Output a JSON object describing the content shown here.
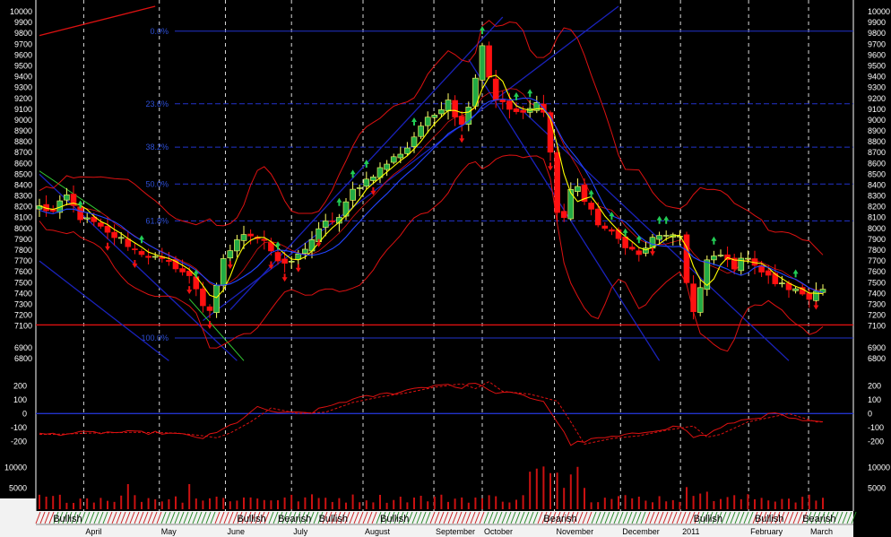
{
  "colors": {
    "background": "#000000",
    "grid": "#ffffff",
    "fib": "#2233cc",
    "support": "#dd1111",
    "bands": "#dd1111",
    "up_candle": "#ffff66",
    "down_candle": "#ff1111",
    "ma_fast": "#ffff00",
    "trend_channel": "#1a22bb",
    "arrow_buy": "#22cc55",
    "arrow_sell": "#ee1111",
    "volume": "#cc1111",
    "strip": "#f2f2f2"
  },
  "chart_data": [
    {
      "type": "candlestick",
      "panel": "price",
      "ylim": [
        6700,
        10050
      ],
      "y_ticks": [
        10000,
        9900,
        9800,
        9700,
        9600,
        9500,
        9400,
        9300,
        9200,
        9100,
        9000,
        8900,
        8800,
        8700,
        8600,
        8500,
        8400,
        8300,
        8200,
        8100,
        8000,
        7900,
        7800,
        7700,
        7600,
        7500,
        7400,
        7300,
        7200,
        7100,
        6900,
        6800
      ],
      "x_months": [
        "April",
        "May",
        "June",
        "July",
        "August",
        "September",
        "October",
        "November",
        "December",
        "2011",
        "February",
        "March"
      ],
      "month_boundaries": [
        6.5,
        17.6,
        27.3,
        37,
        47.5,
        57.9,
        65,
        75.6,
        85.3,
        94.1,
        104.1,
        112.9
      ],
      "close_path": [
        [
          0,
          8200
        ],
        [
          2,
          8150
        ],
        [
          4,
          8300
        ],
        [
          6,
          8100
        ],
        [
          8,
          8050
        ],
        [
          10,
          7950
        ],
        [
          12,
          7900
        ],
        [
          14,
          7800
        ],
        [
          16,
          7750
        ],
        [
          18,
          7700
        ],
        [
          20,
          7650
        ],
        [
          22,
          7550
        ],
        [
          23,
          7450
        ],
        [
          24,
          7300
        ],
        [
          25,
          7250
        ],
        [
          26,
          7450
        ],
        [
          27,
          7700
        ],
        [
          29,
          7900
        ],
        [
          31,
          7950
        ],
        [
          33,
          7900
        ],
        [
          35,
          7700
        ],
        [
          36,
          7650
        ],
        [
          38,
          7750
        ],
        [
          40,
          7900
        ],
        [
          42,
          8050
        ],
        [
          44,
          8100
        ],
        [
          46,
          8350
        ],
        [
          48,
          8450
        ],
        [
          50,
          8550
        ],
        [
          52,
          8650
        ],
        [
          54,
          8750
        ],
        [
          56,
          8950
        ],
        [
          58,
          9050
        ],
        [
          60,
          9200
        ],
        [
          61,
          9050
        ],
        [
          62,
          8950
        ],
        [
          63,
          9150
        ],
        [
          64,
          9400
        ],
        [
          65,
          9700
        ],
        [
          66,
          9400
        ],
        [
          67,
          9200
        ],
        [
          69,
          9100
        ],
        [
          71,
          9050
        ],
        [
          73,
          9150
        ],
        [
          74,
          9100
        ],
        [
          75,
          8700
        ],
        [
          76,
          8150
        ],
        [
          77,
          8100
        ],
        [
          78,
          8350
        ],
        [
          79,
          8400
        ],
        [
          80,
          8250
        ],
        [
          82,
          8050
        ],
        [
          84,
          7950
        ],
        [
          86,
          7850
        ],
        [
          88,
          7750
        ],
        [
          90,
          7900
        ],
        [
          92,
          7950
        ],
        [
          94,
          7900
        ],
        [
          95,
          7500
        ],
        [
          96,
          7250
        ],
        [
          97,
          7450
        ],
        [
          98,
          7700
        ],
        [
          100,
          7750
        ],
        [
          102,
          7650
        ],
        [
          104,
          7750
        ],
        [
          106,
          7600
        ],
        [
          108,
          7500
        ],
        [
          110,
          7450
        ],
        [
          112,
          7400
        ],
        [
          113,
          7350
        ],
        [
          114,
          7450
        ]
      ],
      "horizontal_levels": [
        {
          "label": "0.0%",
          "value": 9820,
          "style": "solid"
        },
        {
          "label": "23.6%",
          "value": 9150,
          "style": "dashed"
        },
        {
          "label": "38.2%",
          "value": 8750,
          "style": "dashed"
        },
        {
          "label": "50.0%",
          "value": 8410,
          "style": "dashed"
        },
        {
          "label": "61.8%",
          "value": 8070,
          "style": "dashed"
        },
        {
          "label": "100.0%",
          "value": 6990,
          "style": "solid"
        }
      ],
      "support_level": 7110,
      "trend_lines": [
        {
          "from": [
            0,
            7700
          ],
          "to": [
            19,
            6780
          ]
        },
        {
          "from": [
            0,
            8500
          ],
          "to": [
            29,
            6780
          ]
        },
        {
          "from": [
            24,
            7150
          ],
          "to": [
            85,
            10050
          ]
        },
        {
          "from": [
            28,
            7250
          ],
          "to": [
            68,
            9950
          ]
        },
        {
          "from": [
            63,
            9560
          ],
          "to": [
            91,
            6780
          ]
        },
        {
          "from": [
            69,
            9200
          ],
          "to": [
            110,
            6780
          ]
        },
        {
          "from": [
            0,
            9780
          ],
          "to": [
            17,
            10050
          ]
        }
      ]
    },
    {
      "type": "line",
      "panel": "oscillator",
      "ylim": [
        -250,
        280
      ],
      "y_ticks": [
        200,
        100,
        0,
        -100,
        -200
      ],
      "zero_line": 0,
      "series_values": [
        [
          0,
          -150
        ],
        [
          6,
          -140
        ],
        [
          12,
          -135
        ],
        [
          18,
          -140
        ],
        [
          22,
          -160
        ],
        [
          24,
          -175
        ],
        [
          26,
          -140
        ],
        [
          29,
          -60
        ],
        [
          32,
          40
        ],
        [
          36,
          0
        ],
        [
          40,
          10
        ],
        [
          44,
          80
        ],
        [
          48,
          120
        ],
        [
          52,
          150
        ],
        [
          56,
          190
        ],
        [
          60,
          215
        ],
        [
          62,
          180
        ],
        [
          64,
          230
        ],
        [
          66,
          160
        ],
        [
          70,
          140
        ],
        [
          74,
          90
        ],
        [
          76,
          -60
        ],
        [
          78,
          -220
        ],
        [
          82,
          -180
        ],
        [
          86,
          -160
        ],
        [
          90,
          -120
        ],
        [
          94,
          -90
        ],
        [
          96,
          -170
        ],
        [
          98,
          -150
        ],
        [
          102,
          -60
        ],
        [
          106,
          -20
        ],
        [
          108,
          0
        ],
        [
          112,
          -60
        ],
        [
          114,
          -60
        ]
      ]
    },
    {
      "type": "bar",
      "panel": "volume",
      "ylim": [
        0,
        13500
      ],
      "y_ticks": [
        10000,
        5000
      ]
    }
  ],
  "regime_labels": [
    {
      "text": "Bullish",
      "x": 2
    },
    {
      "text": "Bullish",
      "x": 29
    },
    {
      "text": "Bearish",
      "x": 35
    },
    {
      "text": "Bullish",
      "x": 41
    },
    {
      "text": "Bullish",
      "x": 50
    },
    {
      "text": "Bearish",
      "x": 74
    },
    {
      "text": "Bullish",
      "x": 96
    },
    {
      "text": "Bullish",
      "x": 105
    },
    {
      "text": "Bearish",
      "x": 112
    }
  ]
}
